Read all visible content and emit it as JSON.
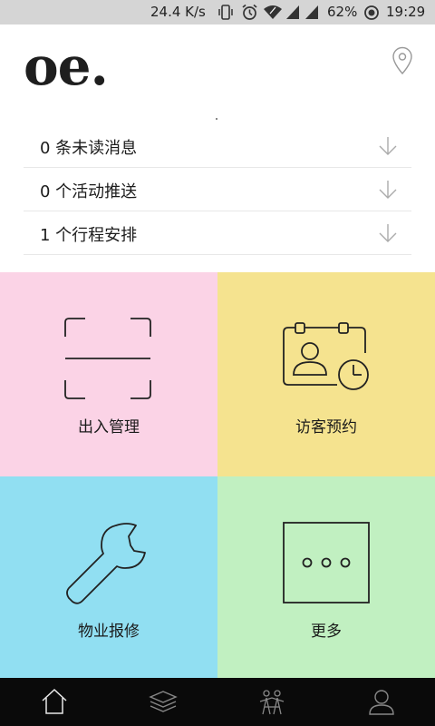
{
  "status_bar": {
    "speed": "24.4 K/s",
    "battery": "62%",
    "time": "19:29",
    "background": "#d5d5d5"
  },
  "header": {
    "logo": "oe."
  },
  "notifications": [
    {
      "label": "0 条未读消息"
    },
    {
      "label": "0 个活动推送"
    },
    {
      "label": "1 个行程安排"
    }
  ],
  "tiles": [
    {
      "label": "出入管理",
      "color": "#fbd3e6",
      "icon": "scan-frame-icon"
    },
    {
      "label": "访客预约",
      "color": "#f5e38f",
      "icon": "visitor-card-clock-icon"
    },
    {
      "label": "物业报修",
      "color": "#91dff2",
      "icon": "wrench-icon"
    },
    {
      "label": "更多",
      "color": "#c1f0c1",
      "icon": "more-dots-icon"
    }
  ],
  "tab_bar": {
    "background": "#0a0a0a",
    "tabs": [
      {
        "icon": "home-icon"
      },
      {
        "icon": "layers-icon"
      },
      {
        "icon": "community-icon"
      },
      {
        "icon": "profile-icon"
      }
    ]
  }
}
